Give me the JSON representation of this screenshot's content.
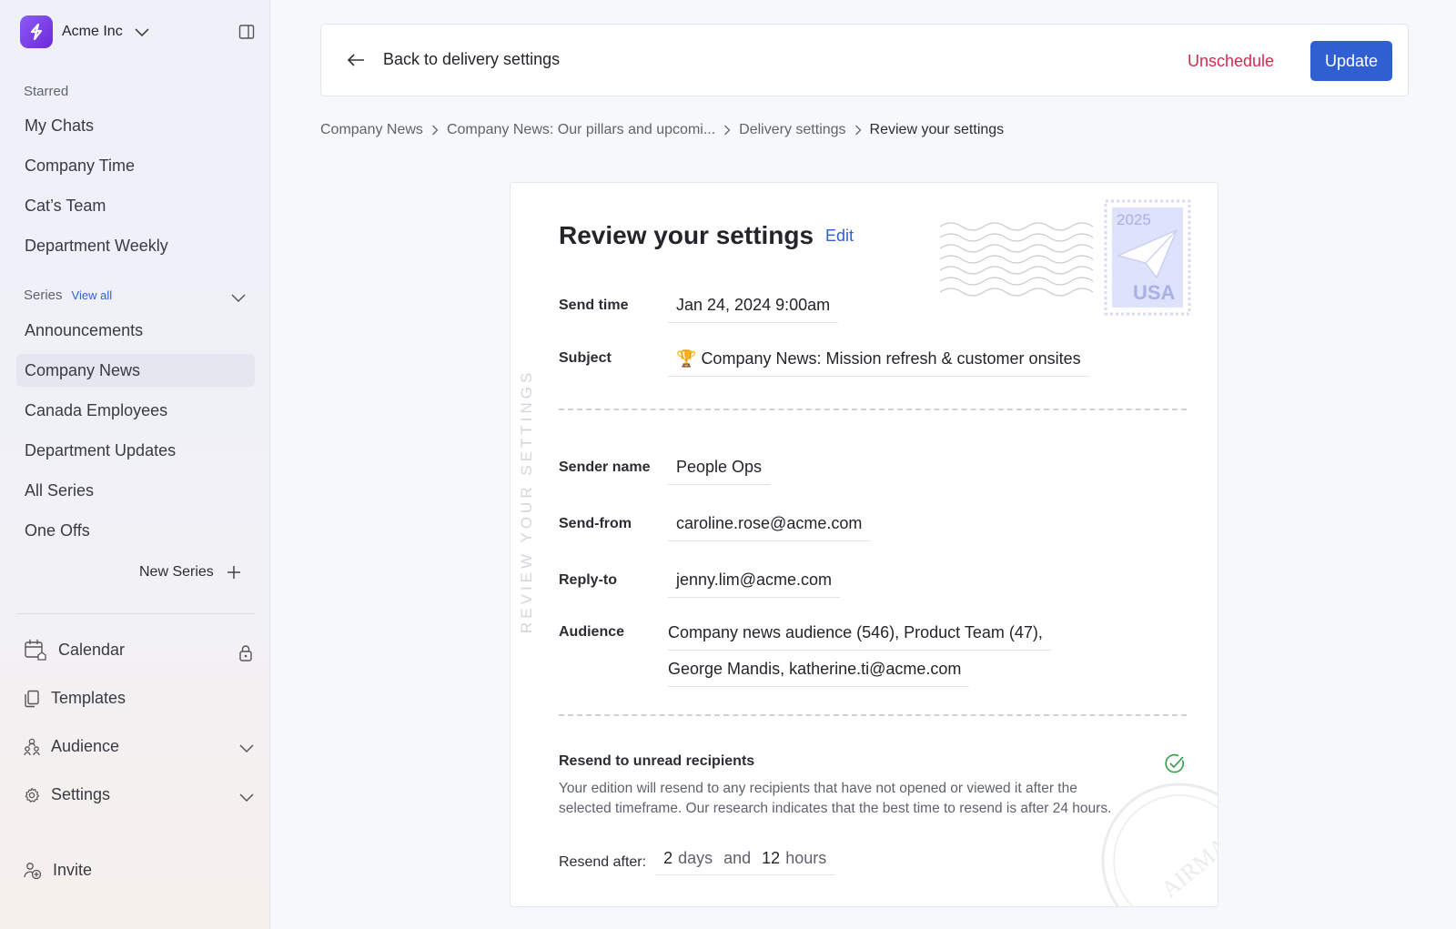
{
  "sidebar": {
    "org_name": "Acme Inc",
    "starred_label": "Starred",
    "starred_items": [
      {
        "label": "My Chats"
      },
      {
        "label": "Company Time"
      },
      {
        "label": "Cat’s Team"
      },
      {
        "label": "Department Weekly"
      }
    ],
    "series_label": "Series",
    "view_all_label": "View all",
    "series_items": [
      {
        "label": "Announcements",
        "active": false
      },
      {
        "label": "Company News",
        "active": true
      },
      {
        "label": "Canada Employees",
        "active": false
      },
      {
        "label": "Department Updates",
        "active": false
      },
      {
        "label": "All Series",
        "active": false
      },
      {
        "label": "One Offs",
        "active": false
      }
    ],
    "new_series_label": "New Series",
    "bottom_items": [
      {
        "label": "Calendar",
        "icon": "calendar-icon"
      },
      {
        "label": "Templates",
        "icon": "templates-icon"
      },
      {
        "label": "Audience",
        "icon": "audience-icon"
      },
      {
        "label": "Settings",
        "icon": "gear-icon"
      }
    ],
    "invite_label": "Invite"
  },
  "topbar": {
    "back_label": "Back to delivery settings",
    "unschedule_label": "Unschedule",
    "update_label": "Update"
  },
  "breadcrumb": [
    "Company News",
    "Company News: Our pillars and upcomi...",
    "Delivery settings",
    "Review your settings"
  ],
  "card": {
    "vertical_label": "REVIEW YOUR SETTINGS",
    "title": "Review your settings",
    "edit_label": "Edit",
    "stamp_year": "2025",
    "stamp_country": "USA",
    "fields": {
      "send_time_label": "Send time",
      "send_time_value": "Jan 24, 2024 9:00am",
      "subject_label": "Subject",
      "subject_emoji": "🏆",
      "subject_value": "Company News: Mission refresh & customer onsites",
      "sender_name_label": "Sender name",
      "sender_name_value": "People Ops",
      "send_from_label": "Send-from",
      "send_from_value": "caroline.rose@acme.com",
      "reply_to_label": "Reply-to",
      "reply_to_value": "jenny.lim@acme.com",
      "audience_label": "Audience",
      "audience_line1": "Company news audience (546), Product Team (47),",
      "audience_line2": "George Mandis, katherine.ti@acme.com"
    },
    "resend": {
      "title": "Resend to unread recipients",
      "description": "Your edition will resend to any recipients that have not opened or viewed it after the selected timeframe. Our research indicates that the best time to resend is after 24 hours.",
      "after_label": "Resend after:",
      "days_value": "2",
      "days_unit": "days",
      "and_word": "and",
      "hours_value": "12",
      "hours_unit": "hours",
      "enabled": true
    },
    "airmail_text": "AIRMAIL"
  },
  "colors": {
    "accent": "#2f5fd0",
    "danger": "#e0244e",
    "success": "#2f9e44",
    "brand": "#7c3aed"
  }
}
